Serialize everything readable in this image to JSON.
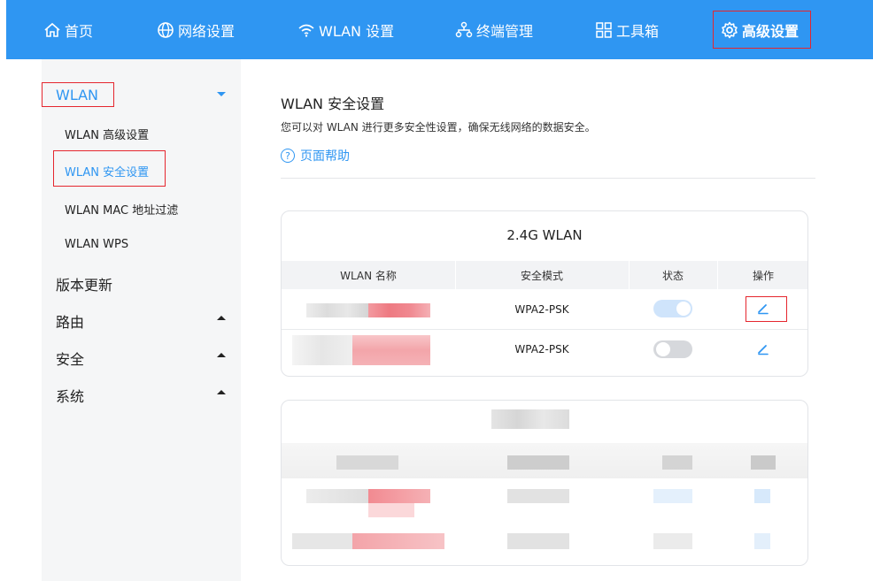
{
  "nav": {
    "items": [
      {
        "label": "首页",
        "icon": "home-icon"
      },
      {
        "label": "网络设置",
        "icon": "globe-icon"
      },
      {
        "label": "WLAN 设置",
        "icon": "wifi-icon"
      },
      {
        "label": "终端管理",
        "icon": "devices-icon"
      },
      {
        "label": "工具箱",
        "icon": "toolbox-icon"
      },
      {
        "label": "高级设置",
        "icon": "gear-icon",
        "active": true
      }
    ]
  },
  "sidebar": {
    "wlan": "WLAN",
    "wlan_sub": [
      "WLAN 高级设置",
      "WLAN 安全设置",
      "WLAN MAC 地址过滤",
      "WLAN WPS"
    ],
    "version": "版本更新",
    "routing": "路由",
    "security": "安全",
    "system": "系统"
  },
  "main": {
    "title": "WLAN 安全设置",
    "description": "您可以对 WLAN 进行更多安全性设置，确保无线网络的数据安全。",
    "help": "页面帮助",
    "help_icon": "?"
  },
  "table_24g": {
    "title": "2.4G WLAN",
    "headers": [
      "WLAN 名称",
      "安全模式",
      "状态",
      "操作"
    ],
    "rows": [
      {
        "security_mode": "WPA2-PSK",
        "enabled": true
      },
      {
        "security_mode": "WPA2-PSK",
        "enabled": false
      }
    ]
  },
  "colors": {
    "accent": "#2f96f2",
    "highlight_border": "#e5262e",
    "toggle_on": "#cfe4fb",
    "toggle_off": "#d6d8dc"
  }
}
